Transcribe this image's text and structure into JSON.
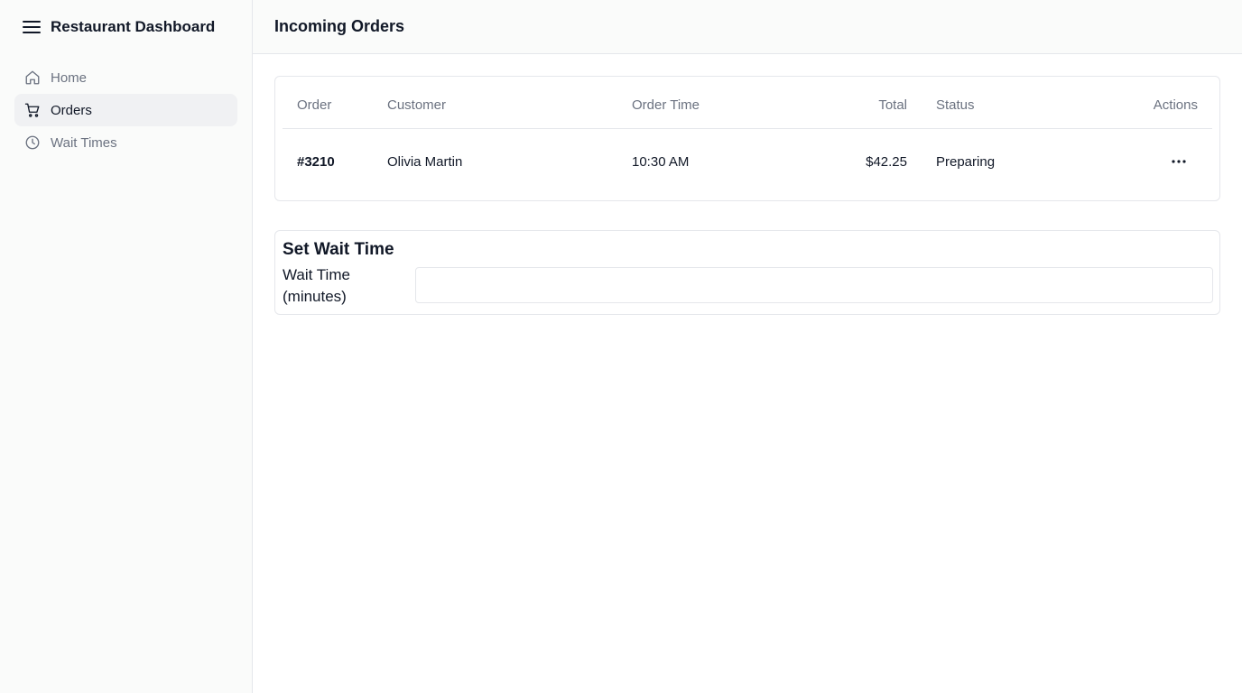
{
  "app": {
    "title": "Restaurant Dashboard"
  },
  "sidebar": {
    "items": [
      {
        "label": "Home",
        "icon": "home-icon",
        "active": false
      },
      {
        "label": "Orders",
        "icon": "cart-icon",
        "active": true
      },
      {
        "label": "Wait Times",
        "icon": "clock-icon",
        "active": false
      }
    ]
  },
  "header": {
    "title": "Incoming Orders"
  },
  "orders": {
    "columns": [
      "Order",
      "Customer",
      "Order Time",
      "Total",
      "Status",
      "Actions"
    ],
    "rows": [
      {
        "order": "#3210",
        "customer": "Olivia Martin",
        "time": "10:30 AM",
        "total": "$42.25",
        "status": "Preparing",
        "actions_icon": "more-horizontal-icon"
      }
    ]
  },
  "wait_time": {
    "title": "Set Wait Time",
    "label": "Wait Time (minutes)",
    "value": "",
    "placeholder": ""
  },
  "colors": {
    "sidebar_bg": "#fafbfa",
    "active_item_bg": "#f0f1f3",
    "muted_text": "#6b7280",
    "border": "#e5e7eb"
  }
}
